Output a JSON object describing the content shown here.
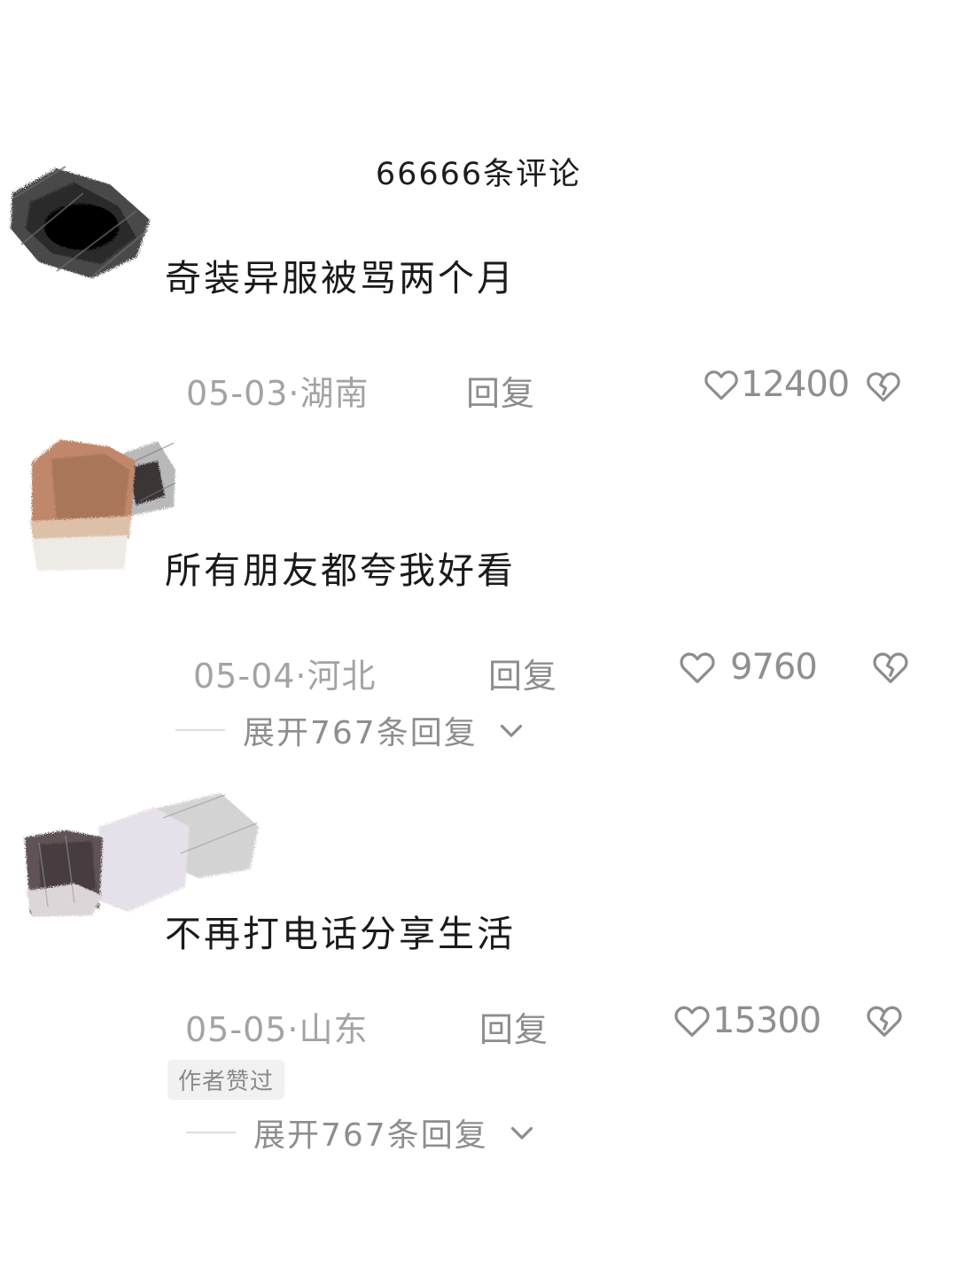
{
  "header": {
    "title": "66666条评论"
  },
  "comments": [
    {
      "text": "奇装异服被骂两个月",
      "date": "05-03",
      "separator": "·",
      "location": "湖南",
      "reply_label": "回复",
      "likes": "12400"
    },
    {
      "text": "所有朋友都夸我好看",
      "date": "05-04",
      "separator": "·",
      "location": "河北",
      "reply_label": "回复",
      "likes": "9760",
      "expand_label": "展开767条回复"
    },
    {
      "text": "不再打电话分享生活",
      "date": "05-05",
      "separator": "·",
      "location": "山东",
      "reply_label": "回复",
      "likes": "15300",
      "badge": "作者赞过",
      "expand_label": "展开767条回复"
    }
  ],
  "icons": {
    "like": "heart-outline-icon",
    "dislike": "broken-heart-icon",
    "expand": "chevron-down-icon"
  },
  "colors": {
    "background": "#ffffff",
    "text_primary": "#1a1a1a",
    "text_secondary": "#a3a3a3",
    "badge_bg": "#f1f1f1"
  }
}
